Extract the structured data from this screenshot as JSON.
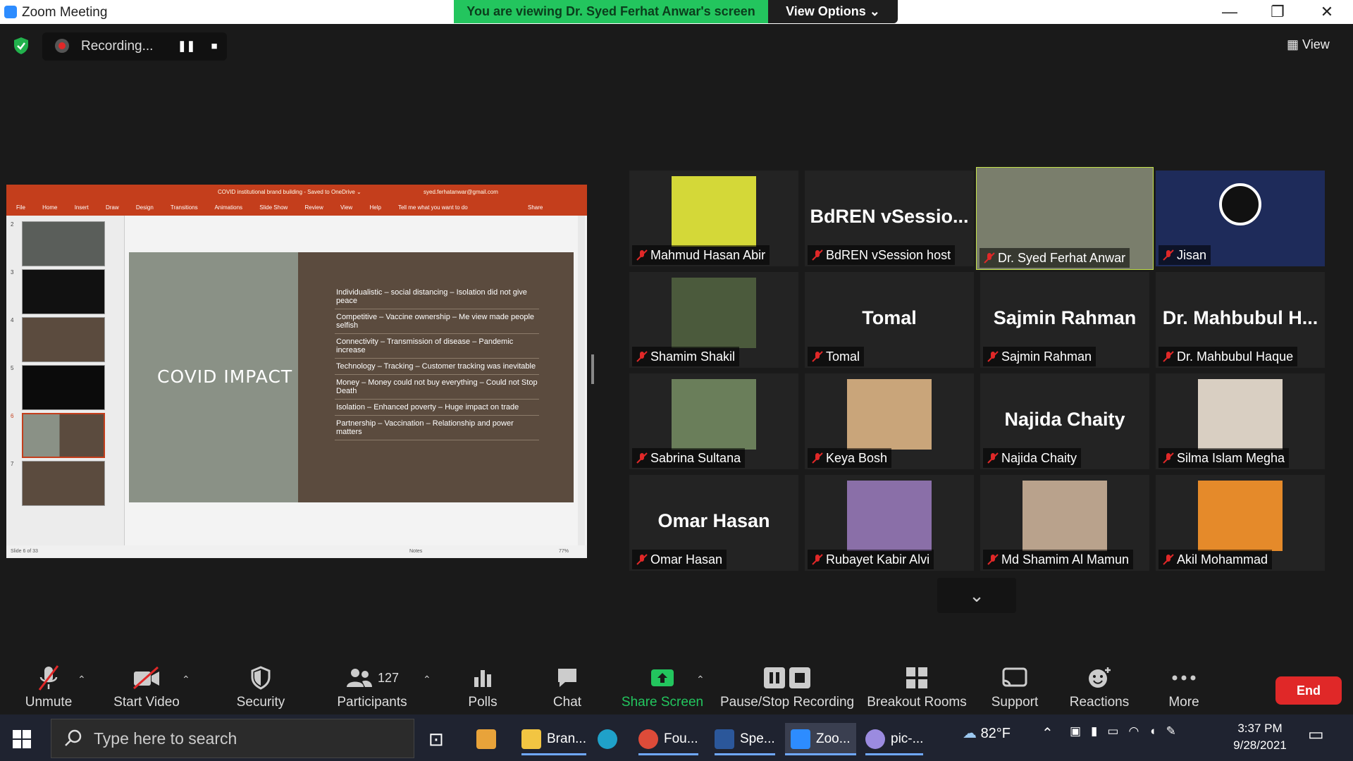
{
  "window": {
    "title": "Zoom Meeting",
    "minimize": "—",
    "restore": "❐",
    "close": "✕"
  },
  "banner": {
    "text": "You are viewing Dr. Syed Ferhat Anwar's screen",
    "view_options": "View Options ⌄"
  },
  "recording": {
    "label": "Recording...",
    "pause": "❚❚",
    "stop": "■"
  },
  "view_button": "▦ View",
  "ppt": {
    "doc_title": "COVID institutional brand building - Saved to OneDrive ⌄",
    "account": "syed.ferhatanwar@gmail.com",
    "tabs": [
      "File",
      "Home",
      "Insert",
      "Draw",
      "Design",
      "Transitions",
      "Animations",
      "Slide Show",
      "Review",
      "View",
      "Help",
      "Tell me what you want to do"
    ],
    "share": "Share",
    "thumb_numbers": [
      "2",
      "3",
      "4",
      "5",
      "6",
      "7"
    ],
    "slide_title": "COVID IMPACT",
    "bullets": [
      "Individualistic – social distancing – Isolation did not give peace",
      "Competitive – Vaccine ownership – Me view made people selfish",
      "Connectivity – Transmission of disease – Pandemic increase",
      "Technology – Tracking – Customer tracking was inevitable",
      "Money – Money could not buy everything – Could not Stop Death",
      "Isolation – Enhanced poverty – Huge impact on trade",
      "Partnership – Vaccination – Relationship and power matters"
    ],
    "status_left": "Slide 6 of 33",
    "status_notes": "Notes",
    "zoom": "77%"
  },
  "participants_grid": [
    {
      "name": "Mahmud Hasan Abir",
      "big": "",
      "photo": "#d4d838"
    },
    {
      "name": "BdREN vSession host",
      "big": "BdREN  vSessio...",
      "photo": ""
    },
    {
      "name": "Dr. Syed Ferhat Anwar",
      "big": "",
      "photo": "#7a7e6c"
    },
    {
      "name": "Jisan",
      "big": "",
      "photo": "#1e2b5a"
    },
    {
      "name": "Shamim Shakil",
      "big": "",
      "photo": "#4b5a3c"
    },
    {
      "name": "Tomal",
      "big": "Tomal",
      "photo": ""
    },
    {
      "name": "Sajmin Rahman",
      "big": "Sajmin Rahman",
      "photo": ""
    },
    {
      "name": "Dr. Mahbubul Haque",
      "big": "Dr.  Mahbubul  H...",
      "photo": ""
    },
    {
      "name": "Sabrina Sultana",
      "big": "",
      "photo": "#6a7e5a"
    },
    {
      "name": "Keya Bosh",
      "big": "",
      "photo": "#c9a57a"
    },
    {
      "name": "Najida Chaity",
      "big": "Najida Chaity",
      "photo": ""
    },
    {
      "name": "Silma Islam Megha",
      "big": "",
      "photo": "#d9cfc2"
    },
    {
      "name": "Omar Hasan",
      "big": "Omar Hasan",
      "photo": ""
    },
    {
      "name": "Rubayet Kabir Alvi",
      "big": "",
      "photo": "#8a6fa8"
    },
    {
      "name": "Md Shamim Al Mamun",
      "big": "",
      "photo": "#b9a28c"
    },
    {
      "name": "Akil Mohammad",
      "big": "",
      "photo": "#e58a2a"
    }
  ],
  "toolbar": {
    "unmute": "Unmute",
    "start_video": "Start Video",
    "security": "Security",
    "participants": "Participants",
    "participants_count": "127",
    "polls": "Polls",
    "chat": "Chat",
    "share_screen": "Share Screen",
    "pause_stop": "Pause/Stop Recording",
    "breakout": "Breakout Rooms",
    "support": "Support",
    "reactions": "Reactions",
    "more": "More",
    "end": "End"
  },
  "taskbar": {
    "search_placeholder": "Type here to search",
    "apps": [
      {
        "label": "Bran...",
        "color": "#f2c542"
      },
      {
        "label": "Fou...",
        "color": "#dd4b39"
      },
      {
        "label": "Spe...",
        "color": "#2b579a"
      },
      {
        "label": "Zoo...",
        "color": "#2d8cff"
      },
      {
        "label": "pic-...",
        "color": "#9b8be0"
      }
    ],
    "weather": "82°F",
    "time": "3:37 PM",
    "date": "9/28/2021"
  },
  "colors": {
    "accent_green": "#23c55e",
    "end_red": "#e02828",
    "active_speaker": "#c4e24a",
    "ppt_red": "#c43e1c"
  }
}
